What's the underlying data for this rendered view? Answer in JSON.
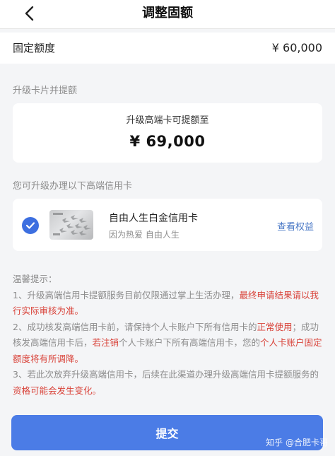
{
  "header": {
    "title": "调整固额"
  },
  "quota": {
    "label": "固定额度",
    "value": "¥ 60,000"
  },
  "upgrade_section": {
    "label": "升级卡片并提额",
    "card_title": "升级高端卡可提额至",
    "amount": "¥ 69,000"
  },
  "card_section": {
    "label": "您可升级办理以下高端信用卡",
    "card": {
      "name": "自由人生白金信用卡",
      "slogan": "因为热爱 自由人生",
      "benefits_link": "查看权益",
      "selected": true
    }
  },
  "tips": {
    "title": "温馨提示：",
    "items": [
      {
        "prefix": "1、升级高端信用卡提额服务目前仅限通过掌上生活办理，",
        "hl1": "最终申请结果请以我行实际审核为准。"
      },
      {
        "prefix": "2、成功核发高端信用卡前，请保持个人卡账户下所有信用卡的",
        "hl1": "正常使用",
        "mid1": "；成功核发高端信用卡后，",
        "hl2": "若注销",
        "mid2": "个人卡账户下所有高端信用卡，您的",
        "hl3": "个人卡账户固定额度将有所调降。"
      },
      {
        "prefix": "3、若此次放弃升级高端信用卡，后续在此渠道办理升级高端信用卡提额服务的",
        "hl1": "资格可能会发生变化。"
      }
    ]
  },
  "submit": {
    "label": "提交"
  },
  "watermark": "知乎 @合肥卡哥",
  "colors": {
    "accent": "#4b7ce6",
    "highlight": "#d9433a",
    "link": "#4a78c6"
  }
}
